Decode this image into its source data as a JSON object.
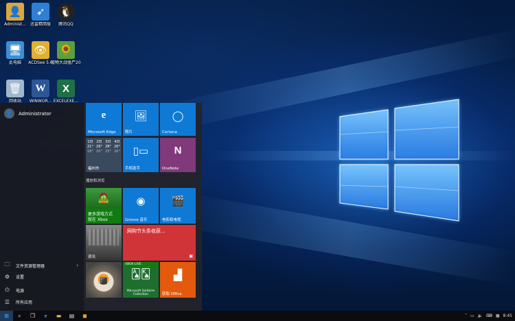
{
  "desktop": {
    "icons": [
      {
        "label": "Administ...",
        "icon": "user-folder-icon",
        "color": "#d9a640"
      },
      {
        "label": "迅雷精简版",
        "icon": "thunder-bird-icon",
        "color": "#2f7fd6"
      },
      {
        "label": "腾讯QQ",
        "icon": "qq-penguin-icon",
        "color": "#222222"
      },
      {
        "label": "此电脑",
        "icon": "computer-icon",
        "color": "#3c8fd6"
      },
      {
        "label": "ACDSee 5.0",
        "icon": "acdsee-eye-icon",
        "color": "#e0b030"
      },
      {
        "label": "植物大战僵尸2010年...",
        "icon": "pvz-plant-icon",
        "color": "#5aa040"
      },
      {
        "label": "回收站",
        "icon": "recycle-bin-icon",
        "color": "#9fb8cc"
      },
      {
        "label": "WINWOR...",
        "icon": "word-icon",
        "color": "#2b5797"
      },
      {
        "label": "EXCELEXE...",
        "icon": "excel-icon",
        "color": "#1e7145"
      }
    ]
  },
  "start_menu": {
    "user_name": "Administrator",
    "left_items": [
      {
        "label": "文件资源管理器",
        "icon": "folder-icon",
        "has_arrow": true
      },
      {
        "label": "设置",
        "icon": "gear-icon",
        "has_arrow": false
      },
      {
        "label": "电源",
        "icon": "power-icon",
        "has_arrow": false
      },
      {
        "label": "所有应用",
        "icon": "all-apps-icon",
        "has_arrow": false
      }
    ],
    "tiles_top": [
      {
        "label": "Microsoft Edge",
        "icon": "edge-icon",
        "color": "#0f7ad6"
      },
      {
        "label": "照片",
        "icon": "photos-icon",
        "color": "#0f7ad6"
      },
      {
        "label": "Cortana",
        "icon": "cortana-icon",
        "color": "#0f7ad6"
      },
      {
        "label": "天气",
        "icon": "weather-icon",
        "color": "#3a4a5e"
      },
      {
        "label": "手机助手",
        "icon": "phone-companion-icon",
        "color": "#0f7ad6"
      },
      {
        "label": "OneNote",
        "icon": "onenote-icon",
        "color": "#80397b"
      }
    ],
    "weather": {
      "days": [
        "1日",
        "2日",
        "3日",
        "4日"
      ],
      "temps": [
        "21°",
        "26°",
        "28°",
        "26°"
      ],
      "lows": [
        "18°",
        "20°",
        "23°",
        "20°"
      ],
      "city": "福州市"
    },
    "section_title": "播放和浏览",
    "tiles_bottom": [
      {
        "label": "更多游戏方式",
        "sublabel": "就在 Xbox",
        "icon": "xbox-game-icon",
        "color": "#107c10"
      },
      {
        "label": "Groove 音乐",
        "icon": "groove-icon",
        "color": "#0f7ad6"
      },
      {
        "label": "电影和电视",
        "icon": "movies-icon",
        "color": "#0f7ad6"
      },
      {
        "label": "资讯",
        "icon": "news-icon",
        "color": "#555555"
      },
      {
        "label": "网购节头条收获... ",
        "icon": "news-headline-icon",
        "color": "#d13438"
      },
      {
        "label": "",
        "icon": "store-image-icon",
        "color": "#555555"
      },
      {
        "label": "Microsoft Solitaire Collection",
        "sublabel": "XBOX LIVE",
        "icon": "solitaire-icon",
        "color": "#1e6e2e"
      },
      {
        "label": "获取 Office",
        "icon": "office-icon",
        "color": "#e35a0e"
      }
    ]
  },
  "taskbar": {
    "buttons": [
      {
        "icon": "windows-start-icon"
      },
      {
        "icon": "search-icon"
      },
      {
        "icon": "task-view-icon"
      },
      {
        "icon": "edge-icon"
      },
      {
        "icon": "file-explorer-icon"
      },
      {
        "icon": "store-icon"
      },
      {
        "icon": "app-icon"
      }
    ],
    "time": "8:45"
  }
}
